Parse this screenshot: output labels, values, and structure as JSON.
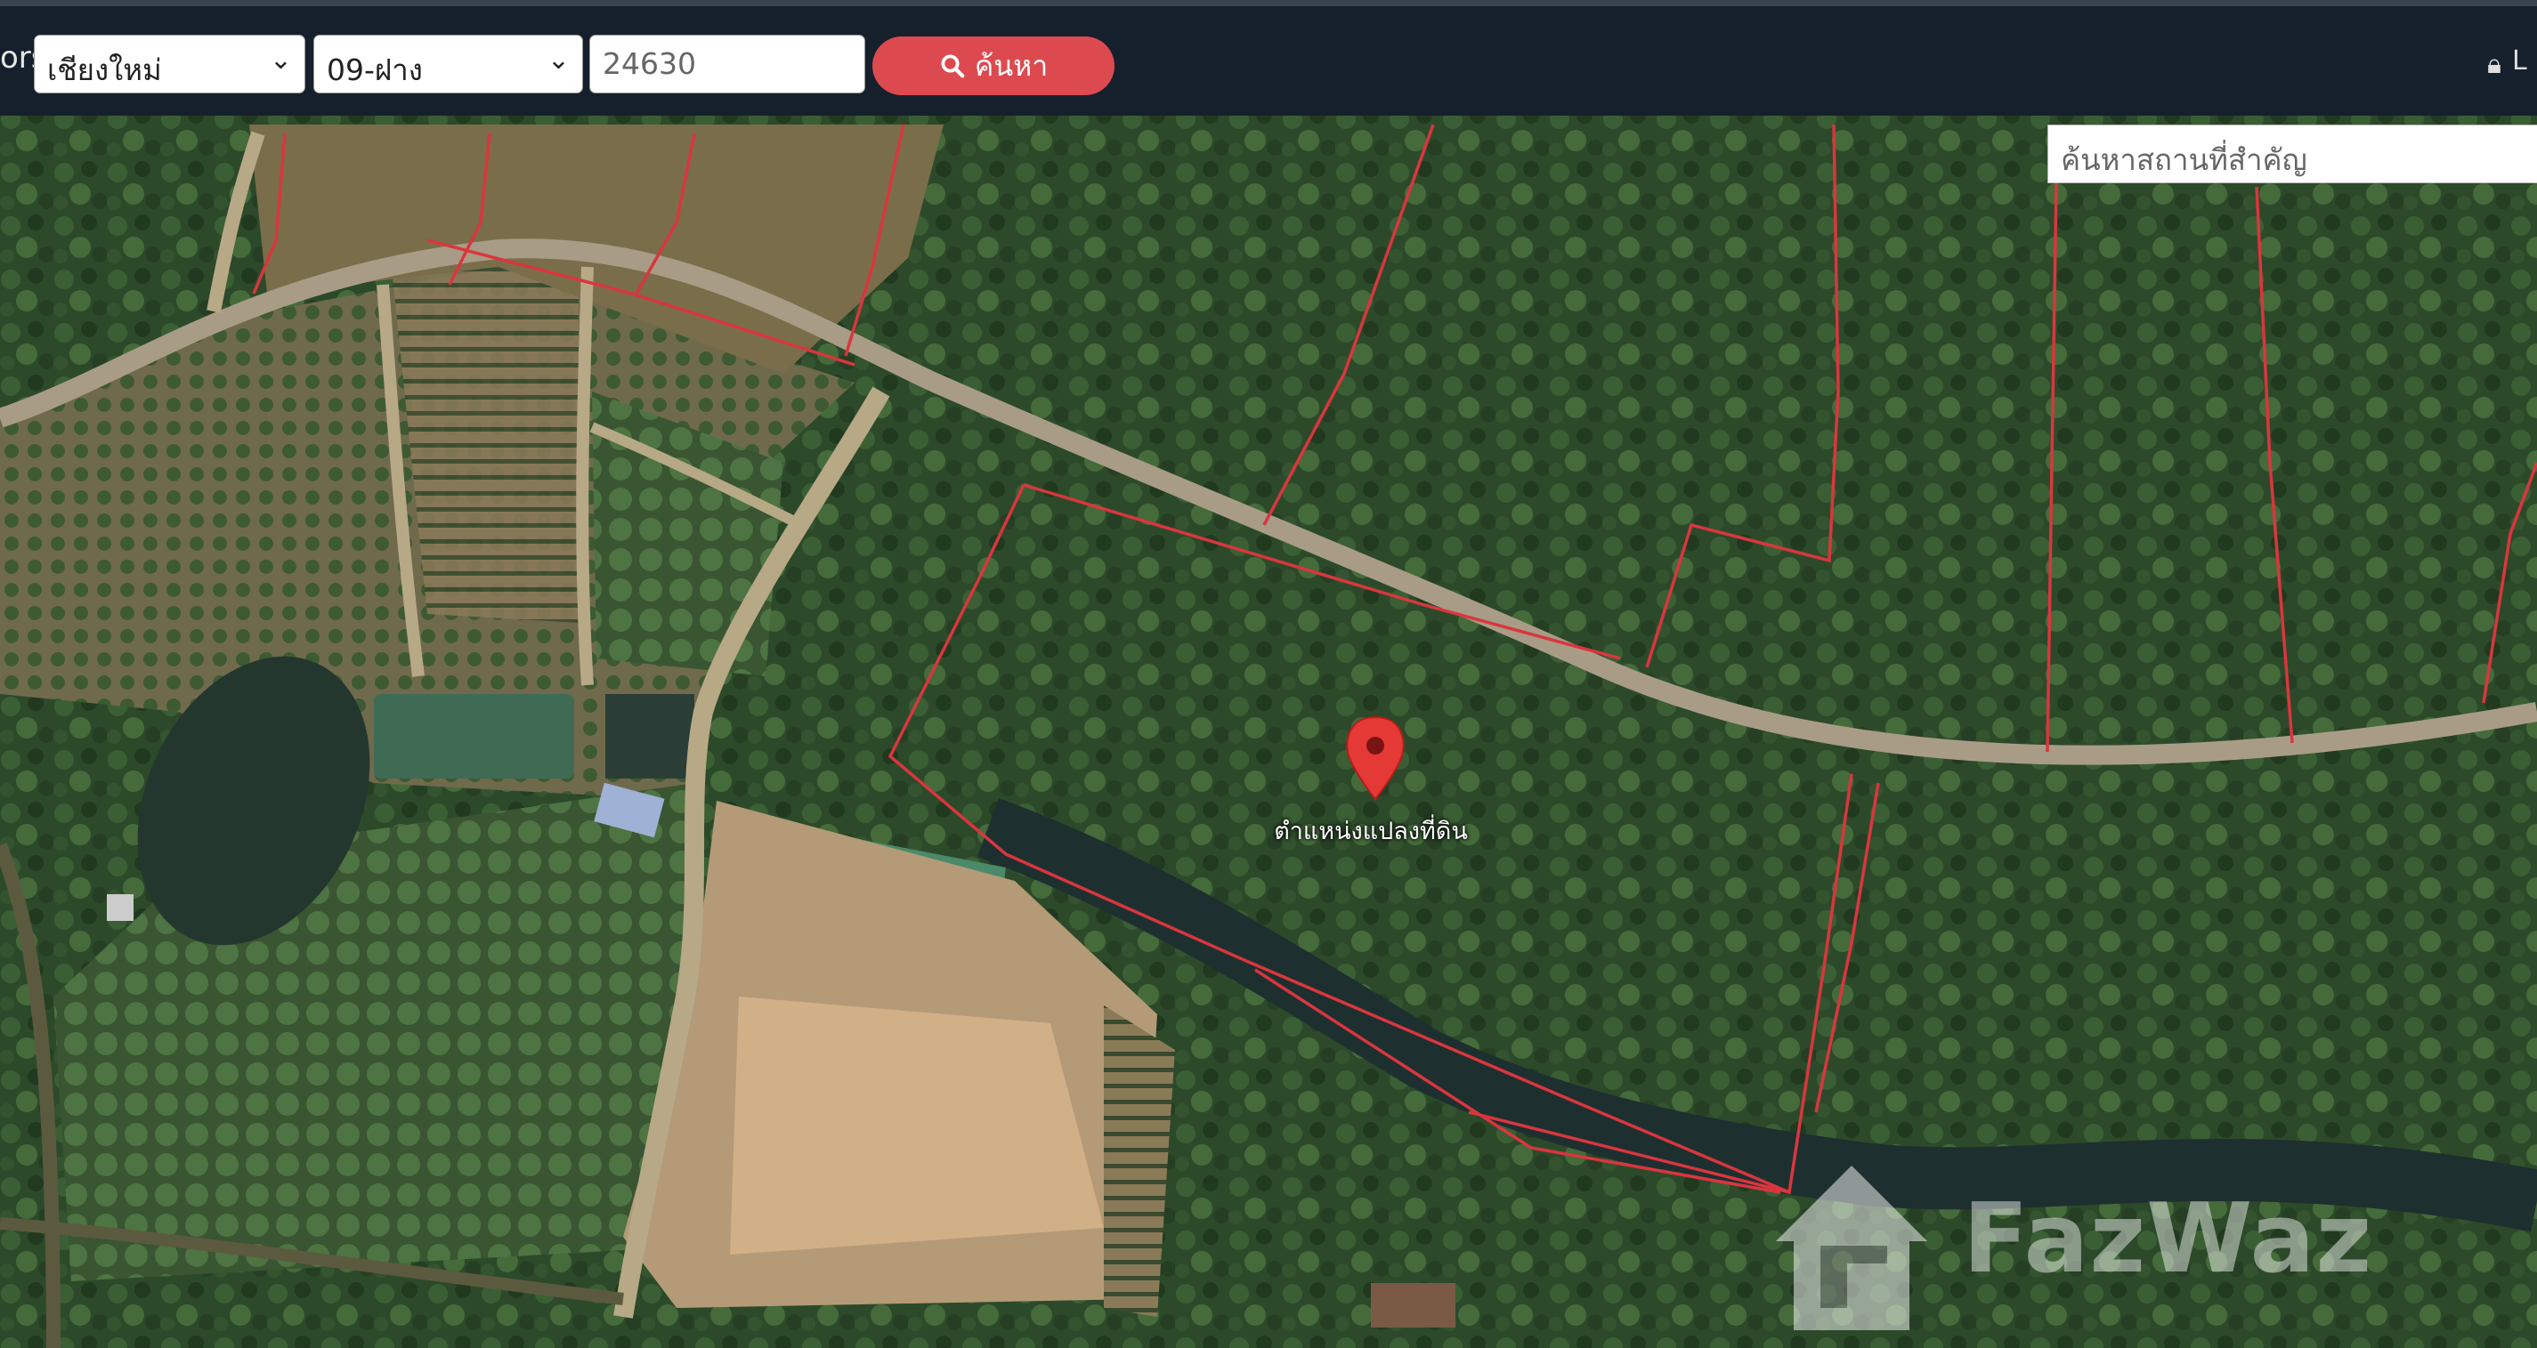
{
  "header": {
    "left_label_clip": "ors",
    "province_select": "เชียงใหม่",
    "district_select": "09-ฝาง",
    "search_input_value": "24630",
    "search_button_label": "ค้นหา",
    "user_label_clip": "L"
  },
  "map": {
    "landmark_search_placeholder": "ค้นหาสถานที่สำคัญ",
    "pin_label": "ตำแหน่งแปลงที่ดิน",
    "watermark": "FazWaz",
    "pin_color": "#e53935",
    "boundary_color": "#d9363e"
  },
  "icons": {
    "search": "search-icon",
    "lock": "lock-icon",
    "pin": "map-pin-icon",
    "logo": "fazwaz-logo-icon"
  }
}
